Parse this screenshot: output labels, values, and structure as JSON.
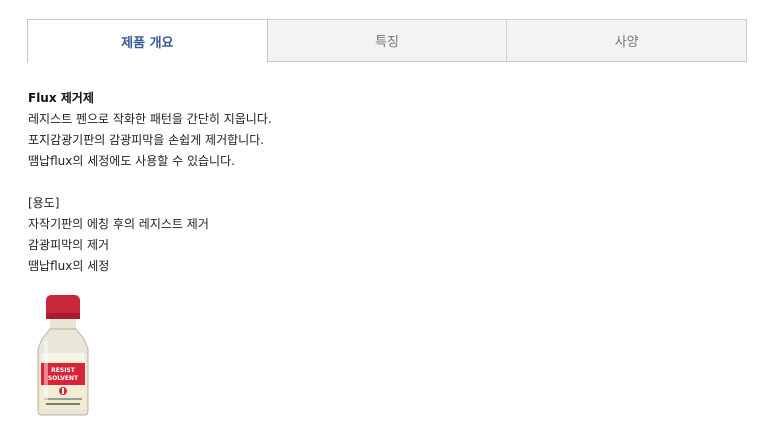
{
  "tabs": [
    {
      "label": "제품 개요",
      "active": true
    },
    {
      "label": "특징",
      "active": false
    },
    {
      "label": "사양",
      "active": false
    }
  ],
  "overview": {
    "title": "Flux 제거제",
    "lines": [
      "레지스트 펜으로 작화한 패턴을 간단히 지웁니다.",
      "포지감광기판의 감광피막을 손쉽게 제거합니다.",
      "땜납flux의 세정에도 사용할 수 있습니다."
    ]
  },
  "usage": {
    "heading": "[용도]",
    "lines": [
      "자작기판의 에칭 후의 레지스트 제거",
      "감광피막의 제거",
      "땜납flux의 세정"
    ]
  },
  "product_image": {
    "label_lines": [
      "RESIST SOLVENT"
    ],
    "cap_color": "#c8283c",
    "label_color": "#d8243a"
  }
}
